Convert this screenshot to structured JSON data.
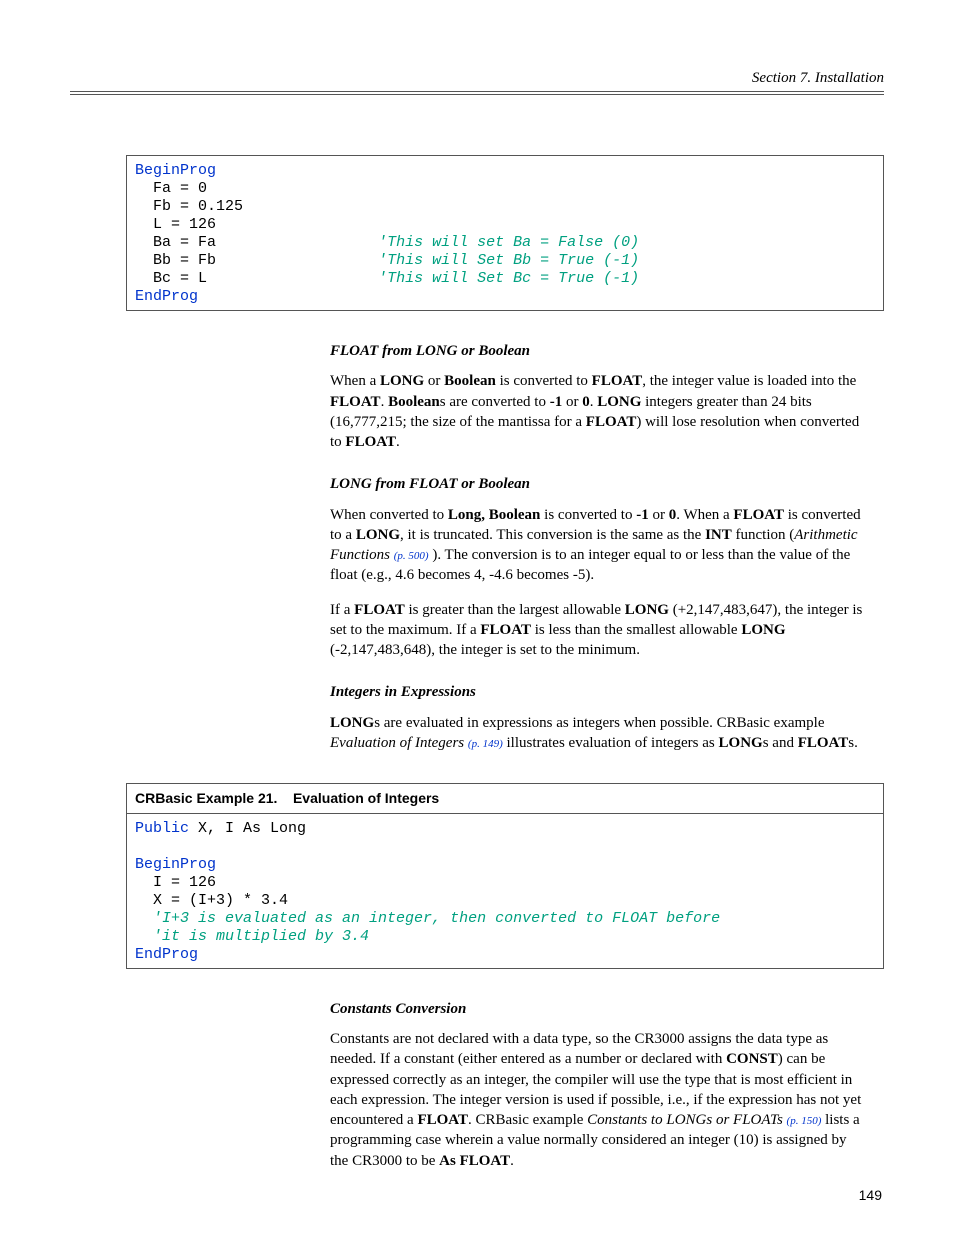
{
  "header": {
    "section": "Section 7.  Installation"
  },
  "code1": {
    "l1_kw": "BeginProg",
    "l2": "Fa = 0",
    "l3": "Fb = 0.125",
    "l4": "L = 126",
    "l5a": "Ba = Fa",
    "l5c": "'This will set Ba = False (0)",
    "l6a": "Bb = Fb",
    "l6c": "'This will Set Bb = True (-1)",
    "l7a": "Bc = L",
    "l7c": "'This will Set Bc = True (-1)",
    "l8_kw": "EndProg"
  },
  "s1": {
    "h": "FLOAT from LONG or Boolean",
    "p1a": "When a ",
    "p1b": "LONG",
    "p1c": " or ",
    "p1d": "Boolean",
    "p1e": " is converted to ",
    "p1f": "FLOAT",
    "p1g": ", the integer value is loaded into the ",
    "p1h": "FLOAT",
    "p1i": ".  ",
    "p1j": "Boolean",
    "p1k": "s are converted to ",
    "p1l": "-1",
    "p1m": " or ",
    "p1n": "0",
    "p1o": ".  ",
    "p1p": "LONG",
    "p1q": " integers greater than 24 bits (16,777,215; the size of the mantissa for a ",
    "p1r": "FLOAT",
    "p1s": ") will lose resolution when converted to ",
    "p1t": "FLOAT",
    "p1u": "."
  },
  "s2": {
    "h": "LONG from FLOAT or Boolean",
    "p1a": "When converted to ",
    "p1b": "Long, Boolean",
    "p1c": " is converted to ",
    "p1d": "-1",
    "p1e": " or ",
    "p1f": "0",
    "p1g": ". When a ",
    "p1h": "FLOAT",
    "p1i": " is converted to a ",
    "p1j": "LONG",
    "p1k": ", it is truncated. This conversion is the same as the ",
    "p1l": "INT",
    "p1m": " function (",
    "p1n": "Arithmetic Functions ",
    "p1o": "(p. 500)",
    "p1p": " ). The conversion is to an integer equal to or less than the value of the float (e.g., 4.6 becomes 4, -4.6 becomes -5).",
    "p2a": "If a ",
    "p2b": "FLOAT",
    "p2c": " is greater than the largest allowable ",
    "p2d": "LONG",
    "p2e": " (+2,147,483,647), the integer is set to the maximum. If a ",
    "p2f": "FLOAT",
    "p2g": " is less than the smallest allowable ",
    "p2h": "LONG",
    "p2i": " (-2,147,483,648), the integer is set to the minimum."
  },
  "s3": {
    "h": "Integers in Expressions",
    "p1a": "LONG",
    "p1b": "s are evaluated in expressions as integers when possible. CRBasic example ",
    "p1c": "Evaluation of Integers ",
    "p1d": "(p. 149)",
    "p1e": " illustrates evaluation of integers as ",
    "p1f": "LONG",
    "p1g": "s and ",
    "p1h": "FLOAT",
    "p1i": "s."
  },
  "code2": {
    "title": "CRBasic Example 21.    Evaluation of Integers",
    "l1_kw": "Public",
    "l1_rest": " X, I As Long",
    "l2_kw": "BeginProg",
    "l3": "I = 126",
    "l4": "X = (I+3) * 3.4",
    "l5c": "'I+3 is evaluated as an integer, then converted to FLOAT before",
    "l6c": "'it is multiplied by 3.4",
    "l7_kw": "EndProg"
  },
  "s4": {
    "h": "Constants Conversion",
    "p1a": "Constants are not declared with a data type, so the CR3000 assigns the data type as needed. If a constant (either entered as a number or declared with ",
    "p1b": "CONST",
    "p1c": ") can be expressed correctly as an integer, the compiler will use the type that is most efficient in each expression. The integer version is used if possible, i.e., if the expression has not yet encountered a ",
    "p1d": "FLOAT",
    "p1e": ". CRBasic example ",
    "p1f": "Constants to LONGs or FLOATs ",
    "p1g": "(p. 150)",
    "p1h": " lists a programming case wherein a value normally considered an integer (10) is assigned by the CR3000 to be ",
    "p1i": "As FLOAT",
    "p1j": "."
  },
  "page_number": "149"
}
